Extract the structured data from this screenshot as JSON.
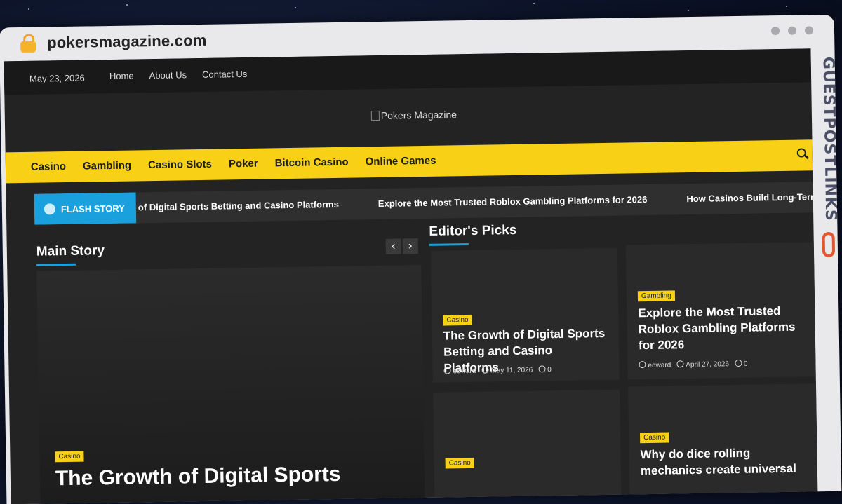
{
  "browser": {
    "url": "pokersmagazine.com"
  },
  "topbar": {
    "date": "May 23, 2026",
    "links": [
      "Home",
      "About Us",
      "Contact Us"
    ]
  },
  "logo": {
    "alt": "Pokers Magazine"
  },
  "nav": {
    "items": [
      "Casino",
      "Gambling",
      "Casino Slots",
      "Poker",
      "Bitcoin Casino",
      "Online Games"
    ]
  },
  "flash": {
    "label": "FLASH STORY",
    "items": [
      "of Digital Sports Betting and Casino Platforms",
      "Explore the Most Trusted Roblox Gambling Platforms for 2026",
      "How Casinos Build Long-Term"
    ]
  },
  "main_story": {
    "heading": "Main Story",
    "prev": "‹",
    "next": "›",
    "category": "Casino",
    "title": "The Growth of Digital Sports"
  },
  "editors_picks": {
    "heading": "Editor's Picks",
    "cards": [
      {
        "category": "Casino",
        "title": "The Growth of Digital Sports Betting and Casino Platforms",
        "author": "edward",
        "date": "May 11, 2026",
        "comments": "0"
      },
      {
        "category": "Gambling",
        "title": "Explore the Most Trusted Roblox Gambling Platforms for 2026",
        "author": "edward",
        "date": "April 27, 2026",
        "comments": "0"
      },
      {
        "category": "Casino",
        "title": "",
        "author": "",
        "date": "",
        "comments": ""
      },
      {
        "category": "Casino",
        "title": "Why do dice rolling mechanics create universal",
        "author": "",
        "date": "",
        "comments": ""
      }
    ]
  },
  "watermark": {
    "text": "GUESTPOSTLINKS"
  },
  "colors": {
    "accent_yellow": "#f8d117",
    "accent_blue": "#1aa0dc",
    "dark_bg": "#232323"
  }
}
